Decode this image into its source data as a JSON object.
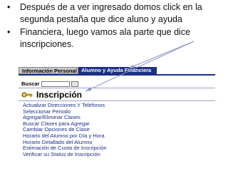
{
  "slide": {
    "bullets": [
      "Después de a ver ingresado domos click en la segunda pestaña que dice aluno y ayuda",
      "Financiera, luego vamos ala parte que dice inscripciones."
    ]
  },
  "screenshot": {
    "tabs": [
      "Información Personal",
      "Alumno y Ayuda Financiera"
    ],
    "search_label": "Buscar",
    "search_value": "",
    "title": "Inscripción",
    "links": [
      "Actualizar Direcciones Y Teléfonos",
      "Seleccionar Periodo",
      "Agregar/Eliminar Clases",
      "Buscar Clases para Agregar",
      "Cambiar Opciones de Clase",
      "Horario del Alumno por Día y Hora",
      "Horario Detallado del Alumno",
      "Estimación de Cuota de Inscripción",
      "Verificar su Status de Inscripción"
    ]
  },
  "colors": {
    "active_tab_bg": "#1a2f86",
    "link_color": "#1a2f86",
    "arrow_color": "#8a95c9"
  }
}
